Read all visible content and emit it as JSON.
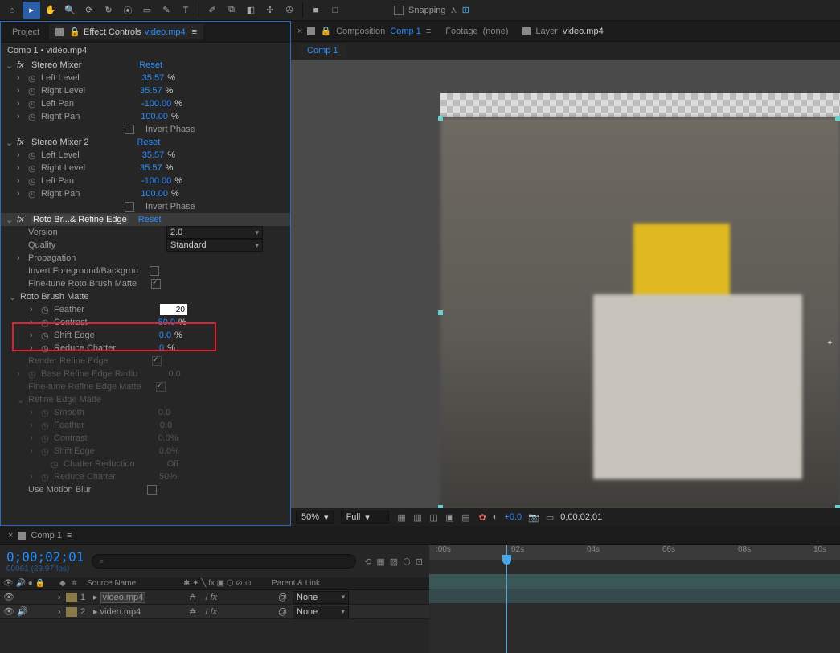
{
  "toolbar": {
    "snapping_label": "Snapping"
  },
  "panels": {
    "project_tab": "Project",
    "effect_controls_tab": "Effect Controls",
    "effect_controls_file": "video.mp4",
    "breadcrumb": "Comp 1 • video.mp4"
  },
  "fx": {
    "stereo_mixer": {
      "name": "Stereo Mixer",
      "reset": "Reset",
      "props": {
        "left_level": {
          "label": "Left Level",
          "value": "35.57",
          "unit": "%"
        },
        "right_level": {
          "label": "Right Level",
          "value": "35.57",
          "unit": "%"
        },
        "left_pan": {
          "label": "Left Pan",
          "value": "-100.00",
          "unit": "%"
        },
        "right_pan": {
          "label": "Right Pan",
          "value": "100.00",
          "unit": "%"
        },
        "invert_phase": {
          "label": "Invert Phase"
        }
      }
    },
    "stereo_mixer_2": {
      "name": "Stereo Mixer 2",
      "reset": "Reset",
      "props": {
        "left_level": {
          "label": "Left Level",
          "value": "35.57",
          "unit": "%"
        },
        "right_level": {
          "label": "Right Level",
          "value": "35.57",
          "unit": "%"
        },
        "left_pan": {
          "label": "Left Pan",
          "value": "-100.00",
          "unit": "%"
        },
        "right_pan": {
          "label": "Right Pan",
          "value": "100.00",
          "unit": "%"
        },
        "invert_phase": {
          "label": "Invert Phase"
        }
      }
    },
    "roto": {
      "name": "Roto Br...& Refine Edge",
      "reset": "Reset",
      "version": {
        "label": "Version",
        "value": "2.0"
      },
      "quality": {
        "label": "Quality",
        "value": "Standard"
      },
      "propagation": {
        "label": "Propagation"
      },
      "invert_fg": {
        "label": "Invert Foreground/Backgrou"
      },
      "fine_tune_rbm": {
        "label": "Fine-tune Roto Brush Matte"
      },
      "rbm": {
        "label": "Roto Brush Matte"
      },
      "feather": {
        "label": "Feather",
        "value": "20"
      },
      "contrast": {
        "label": "Contrast",
        "value": "80.0",
        "unit": "%"
      },
      "shift_edge": {
        "label": "Shift Edge",
        "value": "0.0",
        "unit": "%"
      },
      "reduce_chatter": {
        "label": "Reduce Chatter",
        "value": "0",
        "unit": "%"
      },
      "render_refine": {
        "label": "Render Refine Edge"
      },
      "base_radius": {
        "label": "Base Refine Edge Radiu",
        "value": "0.0"
      },
      "fine_tune_rem": {
        "label": "Fine-tune Refine Edge Matte"
      },
      "rem": {
        "label": "Refine Edge Matte"
      },
      "smooth": {
        "label": "Smooth",
        "value": "0.0"
      },
      "feather2": {
        "label": "Feather",
        "value": "0.0"
      },
      "contrast2": {
        "label": "Contrast",
        "value": "0.0",
        "unit": "%"
      },
      "shift_edge2": {
        "label": "Shift Edge",
        "value": "0.0",
        "unit": "%"
      },
      "chatter_reduction": {
        "label": "Chatter Reduction",
        "value": "Off"
      },
      "reduce_chatter2": {
        "label": "Reduce Chatter",
        "value": "50",
        "unit": "%"
      },
      "motion_blur": {
        "label": "Use Motion Blur"
      }
    }
  },
  "composition": {
    "tab_label": "Composition",
    "comp_name": "Comp 1",
    "footage_label": "Footage",
    "footage_value": "(none)",
    "layer_label": "Layer",
    "layer_value": "video.mp4",
    "sub_tab": "Comp 1"
  },
  "viewer_status": {
    "zoom": "50%",
    "res": "Full",
    "exposure": "+0.0",
    "timecode": "0;00;02;01"
  },
  "timeline": {
    "tab": "Comp 1",
    "timecode": "0;00;02;01",
    "fps": "00061 (29.97 fps)",
    "search_placeholder": "",
    "cols": {
      "num": "#",
      "source": "Source Name",
      "parent": "Parent & Link"
    },
    "layers": [
      {
        "num": "1",
        "name": "video.mp4",
        "link": "None"
      },
      {
        "num": "2",
        "name": "video.mp4",
        "link": "None"
      }
    ],
    "ruler": [
      ":00s",
      "02s",
      "04s",
      "06s",
      "08s",
      "10s"
    ]
  }
}
